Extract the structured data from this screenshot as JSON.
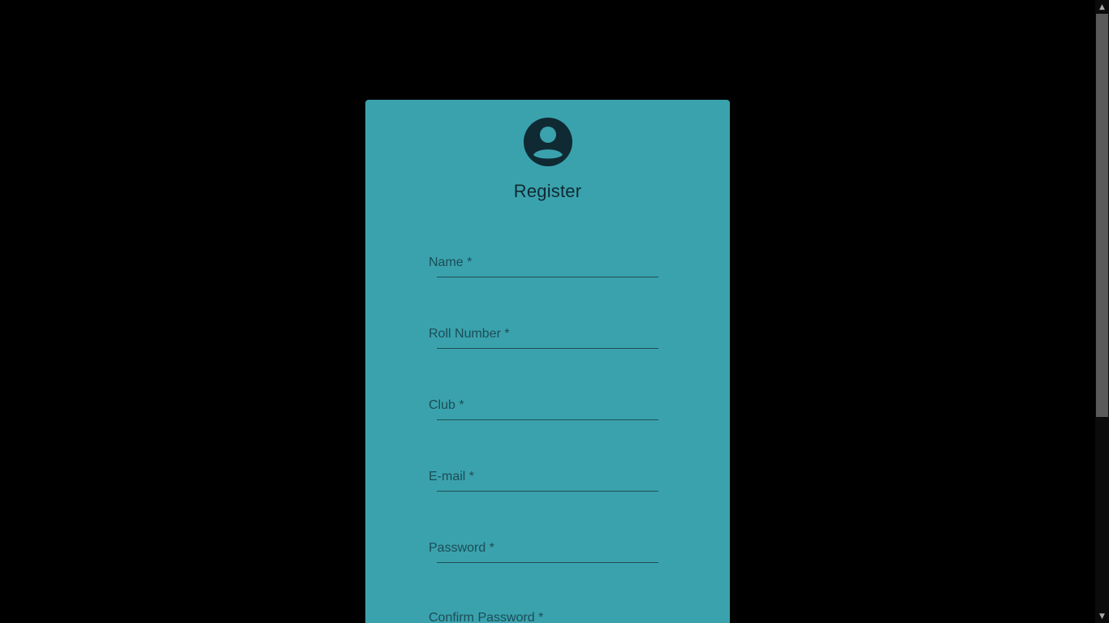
{
  "form": {
    "title": "Register",
    "fields": [
      {
        "label": "Name *",
        "value": ""
      },
      {
        "label": "Roll Number *",
        "value": ""
      },
      {
        "label": "Club *",
        "value": ""
      },
      {
        "label": "E-mail *",
        "value": ""
      },
      {
        "label": "Password *",
        "value": ""
      },
      {
        "label": "Confirm Password *",
        "value": ""
      }
    ]
  },
  "icons": {
    "avatar": "account-circle-icon",
    "scroll_up": "arrow-up-icon",
    "scroll_down": "arrow-down-icon"
  },
  "colors": {
    "background": "#000000",
    "card": "#3aa2ad",
    "text_dark": "#0f2a33",
    "label": "#1b4d57"
  }
}
